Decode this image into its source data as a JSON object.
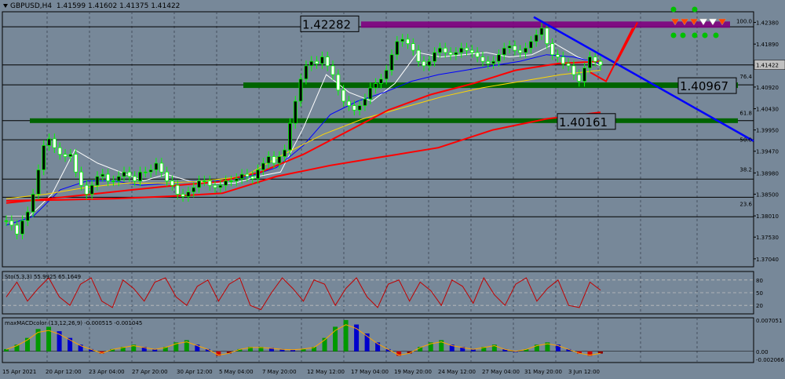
{
  "chart_data": {
    "type": "candlestick",
    "symbol": "GBPUSD,H4",
    "ohlc_readout": [
      "1.41599",
      "1.41602",
      "1.41375",
      "1.41422"
    ],
    "current_price": "1.41422",
    "price_scale": {
      "ylim": [
        1.3686,
        1.4262
      ],
      "ticks": [
        "1.42380",
        "1.41890",
        "1.41400",
        "1.40920",
        "1.40430",
        "1.39950",
        "1.39470",
        "1.38980",
        "1.38500",
        "1.38010",
        "1.37530",
        "1.37040"
      ]
    },
    "time_axis": [
      "15 Apr 2021",
      "20 Apr 12:00",
      "23 Apr 04:00",
      "27 Apr 20:00",
      "30 Apr 12:00",
      "5 May 04:00",
      "7 May 20:00",
      "12 May 12:00",
      "17 May 04:00",
      "19 May 20:00",
      "24 May 12:00",
      "27 May 04:00",
      "31 May 20:00",
      "3 Jun 12:00"
    ],
    "close_series": [
      1.379,
      1.378,
      1.376,
      1.379,
      1.381,
      1.385,
      1.3905,
      1.396,
      1.3975,
      1.3955,
      1.394,
      1.3935,
      1.394,
      1.39,
      1.387,
      1.385,
      1.387,
      1.389,
      1.3895,
      1.388,
      1.388,
      1.389,
      1.39,
      1.389,
      1.388,
      1.39,
      1.39,
      1.3905,
      1.392,
      1.39,
      1.388,
      1.387,
      1.385,
      1.3845,
      1.3855,
      1.3865,
      1.388,
      1.388,
      1.387,
      1.3865,
      1.387,
      1.388,
      1.388,
      1.3885,
      1.3895,
      1.389,
      1.3885,
      1.3905,
      1.392,
      1.3935,
      1.392,
      1.3935,
      1.395,
      1.401,
      1.406,
      1.411,
      1.414,
      1.415,
      1.4145,
      1.416,
      1.414,
      1.412,
      1.4085,
      1.406,
      1.405,
      1.404,
      1.405,
      1.4065,
      1.409,
      1.41,
      1.411,
      1.413,
      1.4165,
      1.4195,
      1.42,
      1.419,
      1.4175,
      1.415,
      1.414,
      1.415,
      1.417,
      1.418,
      1.417,
      1.4165,
      1.417,
      1.418,
      1.4175,
      1.417,
      1.416,
      1.415,
      1.4145,
      1.415,
      1.4165,
      1.418,
      1.4185,
      1.4175,
      1.417,
      1.418,
      1.4195,
      1.421,
      1.4225,
      1.419,
      1.4165,
      1.416,
      1.4145,
      1.414,
      1.412,
      1.4105,
      1.4135,
      1.416,
      1.415,
      1.4142
    ],
    "moving_averages": [
      {
        "color": "#FFFFFF",
        "values": [
          1.38,
          1.38,
          1.385,
          1.395,
          1.392,
          1.39,
          1.388,
          1.3895,
          1.388,
          1.3875,
          1.3875,
          1.389,
          1.39,
          1.4,
          1.412,
          1.408,
          1.406,
          1.41,
          1.417,
          1.416,
          1.4165,
          1.417,
          1.416,
          1.4165,
          1.419,
          1.416,
          1.414
        ]
      },
      {
        "color": "#0000FF",
        "values": [
          1.378,
          1.38,
          1.386,
          1.388,
          1.388,
          1.387,
          1.3875,
          1.388,
          1.388,
          1.389,
          1.391,
          1.396,
          1.403,
          1.406,
          1.408,
          1.4105,
          1.412,
          1.413,
          1.414,
          1.415,
          1.4165,
          1.416,
          1.4145
        ]
      },
      {
        "color": "#FFD700",
        "values": [
          1.384,
          1.385,
          1.3865,
          1.3875,
          1.3875,
          1.388,
          1.389,
          1.394,
          1.3985,
          1.402,
          1.4045,
          1.407,
          1.409,
          1.4105,
          1.412,
          1.413
        ]
      },
      {
        "color": "#FF0000",
        "values": [
          1.383,
          1.384,
          1.385,
          1.386,
          1.387,
          1.3878,
          1.39,
          1.394,
          1.399,
          1.404,
          1.4075,
          1.41,
          1.413,
          1.4145,
          1.415
        ]
      },
      {
        "color": "#FF0000",
        "values": [
          1.3835,
          1.3837,
          1.384,
          1.3845,
          1.3852,
          1.389,
          1.3915,
          1.3935,
          1.3955,
          1.3995,
          1.402,
          1.4035
        ]
      }
    ],
    "horizontal_levels": [
      1.4228,
      1.4142,
      1.4097,
      1.4016,
      1.3973,
      1.3884,
      1.3843,
      1.3799
    ],
    "level_labels": [
      "1.42282",
      "1.40967",
      "1.40161"
    ],
    "fib_labels": [
      {
        "label": "100.0",
        "price": 1.4233
      },
      {
        "label": "76.4",
        "price": 1.4108
      },
      {
        "label": "61.8",
        "price": 1.4025
      },
      {
        "label": "50.0",
        "price": 1.3965
      },
      {
        "label": "38.2",
        "price": 1.3898
      },
      {
        "label": "23.6",
        "price": 1.382
      }
    ],
    "trendline": {
      "from": [
        1.425
      ],
      "to": [
        1.397
      ]
    },
    "stochastic": {
      "label": "Sto(5,3,3) 55.9925 65.1649",
      "ylim": [
        0,
        100
      ],
      "levels": [
        80,
        50,
        20
      ],
      "level_labels": [
        "80",
        "50",
        "20"
      ],
      "values": [
        40,
        75,
        30,
        60,
        85,
        40,
        20,
        70,
        85,
        30,
        15,
        80,
        60,
        30,
        75,
        85,
        40,
        20,
        65,
        80,
        30,
        70,
        85,
        20,
        10,
        50,
        85,
        60,
        30,
        80,
        70,
        20,
        60,
        85,
        40,
        15,
        70,
        80,
        30,
        75,
        55,
        20,
        80,
        65,
        25,
        85,
        45,
        20,
        70,
        85,
        30,
        60,
        80,
        20,
        15,
        75,
        56
      ]
    },
    "macd": {
      "label": "maxMACDcolor (13,12,26,9) -0.000515 -0.001045",
      "ticks": [
        "0.007051",
        "0.00",
        "-0.002066"
      ],
      "ylim": [
        -0.0025,
        0.0075
      ],
      "values": [
        0.0005,
        0.0015,
        0.003,
        0.005,
        0.0055,
        0.0045,
        0.003,
        0.0015,
        0.0005,
        -0.0005,
        0.0005,
        0.001,
        0.0015,
        0.001,
        0.0005,
        0.001,
        0.002,
        0.0025,
        0.0015,
        0.0005,
        -0.001,
        -0.0005,
        0.0005,
        0.001,
        0.001,
        0.0008,
        0.0005,
        0.0004,
        0.0006,
        0.001,
        0.003,
        0.0055,
        0.007,
        0.006,
        0.004,
        0.002,
        0.0005,
        -0.001,
        -0.0005,
        0.001,
        0.002,
        0.0025,
        0.0015,
        0.001,
        0.0005,
        0.001,
        0.0015,
        0.0005,
        0.0,
        0.0005,
        0.0015,
        0.002,
        0.0015,
        0.0005,
        -0.0005,
        -0.001,
        -0.0005
      ]
    }
  }
}
